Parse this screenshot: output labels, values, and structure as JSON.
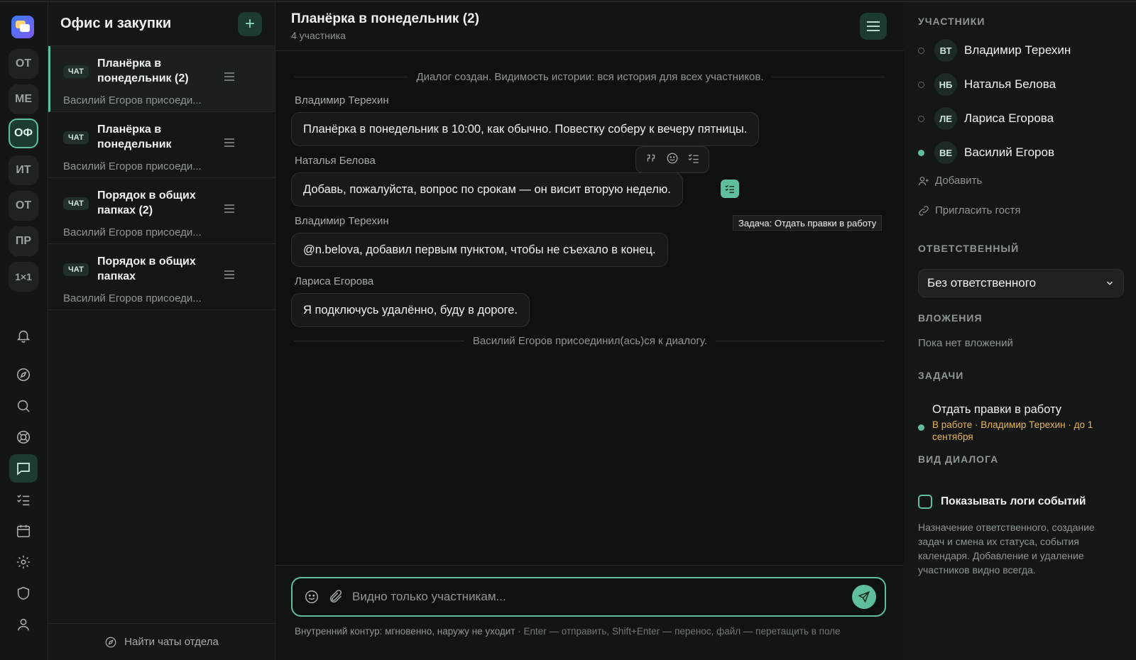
{
  "rail": {
    "spaces": [
      {
        "label": "ОТ"
      },
      {
        "label": "МЕ"
      },
      {
        "label": "ОФ"
      },
      {
        "label": "ИТ"
      },
      {
        "label": "ОТ"
      },
      {
        "label": "ПР"
      },
      {
        "label": "1×1"
      }
    ],
    "icons": [
      "bell-icon",
      "compass-icon",
      "search-icon",
      "lifebuoy-icon",
      "chat-icon",
      "tasks-icon",
      "calendar-icon",
      "gear-icon",
      "shield-icon",
      "user-icon"
    ]
  },
  "list": {
    "title": "Офис и закупки",
    "chats": [
      {
        "tag": "ЧАТ",
        "title": "Планёрка в понедельник (2)",
        "sub": "Василий Егоров присоеди..."
      },
      {
        "tag": "ЧАТ",
        "title": "Планёрка в понедельник",
        "sub": "Василий Егоров присоеди..."
      },
      {
        "tag": "ЧАТ",
        "title": "Порядок в общих папках (2)",
        "sub": "Василий Егоров присоеди..."
      },
      {
        "tag": "ЧАТ",
        "title": "Порядок в общих папках",
        "sub": "Василий Егоров присоеди..."
      }
    ],
    "footer": "Найти чаты отдела"
  },
  "chat": {
    "title": "Планёрка в понедельник (2)",
    "count": "4 участника",
    "system_top": "Диалог создан. Видимость истории: вся история для всех участников.",
    "messages": [
      {
        "author": "Владимир Терехин",
        "text": "Планёрка в понедельник в 10:00, как обычно. Повестку соберу к вечеру пятницы."
      },
      {
        "author": "Наталья Белова",
        "text": "Добавь, пожалуйста, вопрос по срокам — он висит вторую неделю."
      },
      {
        "author": "Владимир Терехин",
        "text": "@n.belova, добавил первым пунктом, чтобы не съехало в конец."
      },
      {
        "author": "Лариса Егорова",
        "text": "Я подключусь удалённо, буду в дороге."
      }
    ],
    "system_bottom": "Василий Егоров присоединил(ась)ся к диалогу.",
    "tooltip": "Задача: Отдать правки в работу",
    "composer_placeholder": "Видно только участникам...",
    "hint_main": "Внутренний контур: мгновенно, наружу не уходит",
    "hint_keys": " · Enter — отправить, Shift+Enter — перенос, файл — перетащить в поле"
  },
  "panel": {
    "members_title": "УЧАСТНИКИ",
    "members": [
      {
        "initials": "ВТ",
        "name": "Владимир Терехин",
        "online": false
      },
      {
        "initials": "НБ",
        "name": "Наталья Белова",
        "online": false
      },
      {
        "initials": "ЛЕ",
        "name": "Лариса Егорова",
        "online": false
      },
      {
        "initials": "ВЕ",
        "name": "Василий Егоров",
        "online": true
      }
    ],
    "add_label": "Добавить",
    "invite_label": "Пригласить гостя",
    "responsible_title": "ОТВЕТСТВЕННЫЙ",
    "responsible_value": "Без ответственного",
    "attachments_title": "ВЛОЖЕНИЯ",
    "attachments_empty": "Пока нет вложений",
    "tasks_title": "ЗАДАЧИ",
    "task_title": "Отдать правки в работу",
    "task_meta": "В работе · Владимир Терехин · до 1 сентября",
    "view_title": "ВИД ДИАЛОГА",
    "show_logs_label": "Показывать логи событий",
    "note": "Назначение ответственного, создание задач и смена их статуса, события календаря. Добавление и удаление участников видно всегда."
  },
  "colors": {
    "accent": "#5fbf9c",
    "warning": "#e5b454",
    "background": "#0d0f0e"
  }
}
